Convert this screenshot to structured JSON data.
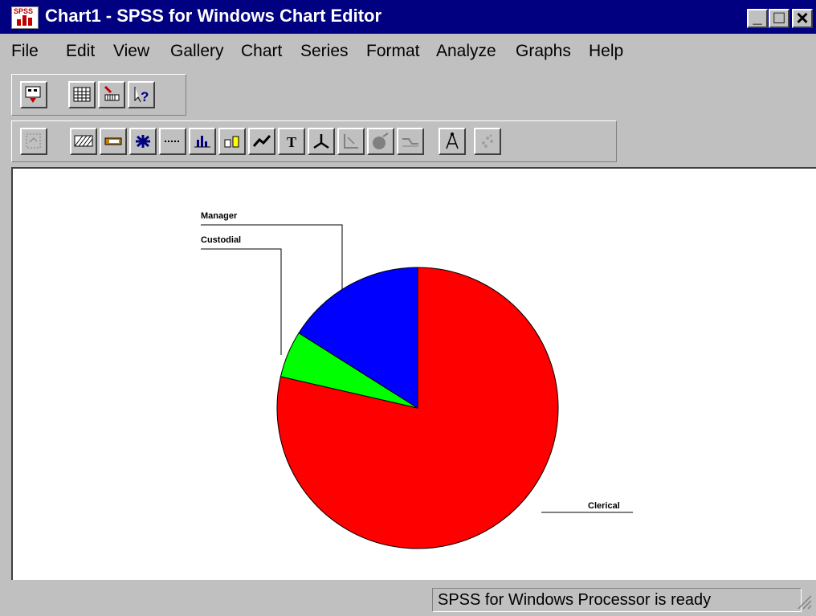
{
  "window": {
    "title": "Chart1 - SPSS for Windows Chart Editor",
    "icon_text": "SPSS"
  },
  "window_controls": {
    "minimize": "_",
    "maximize": "□",
    "close": "×"
  },
  "menu": [
    {
      "label": "File"
    },
    {
      "label": "Edit"
    },
    {
      "label": "View"
    },
    {
      "label": "Gallery"
    },
    {
      "label": "Chart"
    },
    {
      "label": "Series"
    },
    {
      "label": "Format"
    },
    {
      "label": "Analyze"
    },
    {
      "label": "Graphs"
    },
    {
      "label": "Help"
    }
  ],
  "toolbar1": [
    "data-editor-icon",
    "grid-icon",
    "chart-recall-icon",
    "whats-this-icon"
  ],
  "toolbar2": [
    "point-selection-icon",
    "fill-pattern-icon",
    "color-icon",
    "marker-icon",
    "line-style-icon",
    "bar-style-icon",
    "bar-label-icon",
    "interpolation-icon",
    "text-icon",
    "rotate-3d-icon",
    "swap-axes-icon",
    "explode-slice-icon",
    "break-line-icon",
    "spin-mode-icon",
    "point-id-icon"
  ],
  "chart_data": {
    "type": "pie",
    "slices": [
      {
        "label": "Clerical",
        "value": 83.3,
        "color": "#ff0000"
      },
      {
        "label": "Custodial",
        "value": 5.7,
        "color": "#00ff00"
      },
      {
        "label": "Manager",
        "value": 17.0,
        "color": "#0000ff"
      }
    ],
    "start_angle_deg": 0,
    "direction": "clockwise"
  },
  "status": {
    "text": "SPSS for Windows Processor is ready"
  }
}
